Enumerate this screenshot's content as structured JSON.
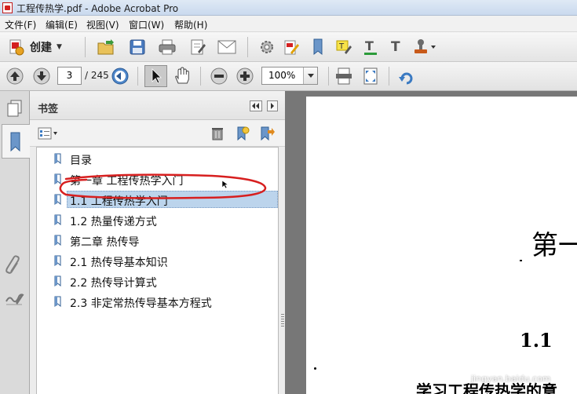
{
  "window": {
    "title": "工程传热学.pdf - Adobe Acrobat Pro"
  },
  "menu": [
    "文件(F)",
    "编辑(E)",
    "视图(V)",
    "窗口(W)",
    "帮助(H)"
  ],
  "toolbar": {
    "create_label": "创建"
  },
  "navigation": {
    "current_page": "3",
    "total_pages": "/ 245",
    "zoom": "100%"
  },
  "bookmarks_panel": {
    "title": "书签",
    "items": [
      {
        "label": "目录"
      },
      {
        "label": "第一章 工程传热学入门"
      },
      {
        "label": "1.1 工程传热学入门"
      },
      {
        "label": "1.2 热量传递方式"
      },
      {
        "label": "第二章 热传导"
      },
      {
        "label": "2.1 热传导基本知识"
      },
      {
        "label": "2.2 热传导计算式"
      },
      {
        "label": "2.3 非定常热传导基本方程式"
      }
    ],
    "selected_index": 2
  },
  "document": {
    "heading": "第一",
    "section_number": "1.1",
    "subheading": "学习工程传热学的意"
  },
  "colors": {
    "annotation_circle": "#d71f1f",
    "selection": "#bcd4ec"
  },
  "watermark": "jingyan.baidu.com"
}
